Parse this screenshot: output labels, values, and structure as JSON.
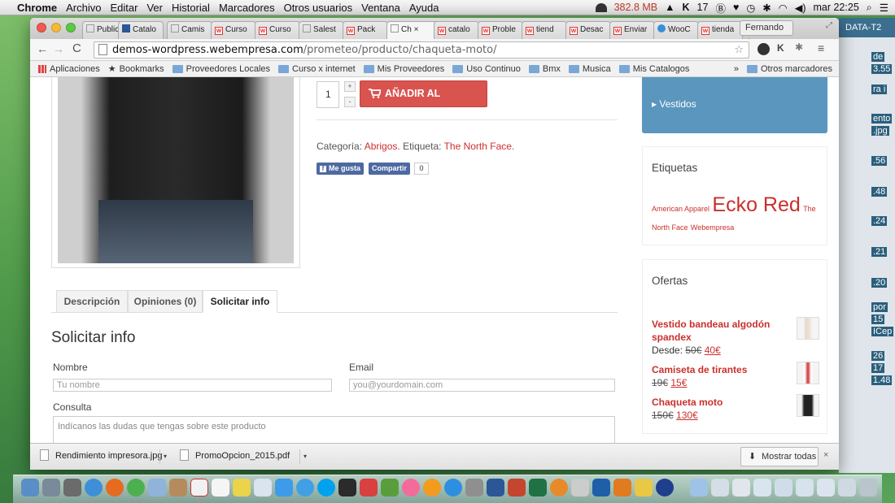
{
  "menubar": {
    "apple": "",
    "app_name": "Chrome",
    "menus": [
      "Archivo",
      "Editar",
      "Ver",
      "Historial",
      "Marcadores",
      "Otros usuarios",
      "Ventana",
      "Ayuda"
    ],
    "memory": "382.8 MB",
    "clock": "mar 22:25",
    "status_text": "17"
  },
  "right_window": {
    "header": "DATA-T2",
    "labels": [
      "de",
      "3.55",
      "ra i",
      "ento",
      ".jpg",
      ".56",
      ".48",
      ".24",
      ".21",
      ".20",
      "por",
      "15",
      "ICep",
      "26",
      "17",
      "1.48"
    ]
  },
  "browser": {
    "tabs": [
      "Public",
      "Catalo",
      "Camis",
      "Curso",
      "Curso",
      "Salest",
      "Pack",
      "Ch",
      "catalo",
      "Proble",
      "tiend",
      "Desac",
      "Enviar",
      "WooC",
      "tienda"
    ],
    "active_tab_index": 7,
    "profile_label": "Fernando",
    "url_domain": "demos-wordpress.webempresa.com",
    "url_path": "/prometeo/producto/chaqueta-moto/",
    "bookmarks": [
      "Aplicaciones",
      "Bookmarks",
      "Proveedores Locales",
      "Curso x internet",
      "Mis Proveedores",
      "Uso Continuo",
      "Bmx",
      "Musica",
      "Mis Catalogos"
    ],
    "bookmarks_more": "»",
    "other_bookmarks": "Otros marcadores"
  },
  "product": {
    "quantity": "1",
    "plus": "+",
    "minus": "-",
    "add_to_cart": "AÑADIR AL CARRITO",
    "category_prefix": "Categoría: ",
    "category": "Abrigos.",
    "tag_prefix": " Etiqueta: ",
    "tag": "The North Face.",
    "fb_like": "Me gusta",
    "fb_share": "Compartir",
    "fb_count": "0"
  },
  "tabs": {
    "items": [
      "Descripción",
      "Opiniones (0)",
      "Solicitar info"
    ],
    "active_index": 2
  },
  "form": {
    "title": "Solicitar info",
    "name_label": "Nombre",
    "name_placeholder": "Tu nombre",
    "email_label": "Email",
    "email_placeholder": "you@yourdomain.com",
    "query_label": "Consulta",
    "query_placeholder": "Indícanos las dudas que tengas sobre este producto"
  },
  "sidebar": {
    "category_item": "Vestidos",
    "tags_title": "Etiquetas",
    "tags": [
      {
        "label": "American Apparel",
        "size": "small"
      },
      {
        "label": "Ecko Red",
        "size": "large"
      },
      {
        "label": "The North Face",
        "size": "small"
      },
      {
        "label": "Webempresa",
        "size": "small"
      }
    ],
    "offers_title": "Ofertas",
    "offers": [
      {
        "name": "Vestido bandeau algodón spandex",
        "prefix": "Desde: ",
        "old": "50€",
        "new": "40€"
      },
      {
        "name": "Camiseta de tirantes",
        "prefix": "",
        "old": "19€",
        "new": "15€"
      },
      {
        "name": "Chaqueta moto",
        "prefix": "",
        "old": "150€",
        "new": "130€"
      }
    ]
  },
  "downloads": {
    "items": [
      "Rendimiento impresora.jpg",
      "PromoOpcion_2015.pdf"
    ],
    "show_all": "Mostrar todas",
    "close": "×"
  },
  "colors": {
    "accent_red": "#d9534f",
    "link_red": "#c9302c",
    "sidebar_blue": "#5a96bd",
    "facebook_blue": "#4e69a2"
  }
}
